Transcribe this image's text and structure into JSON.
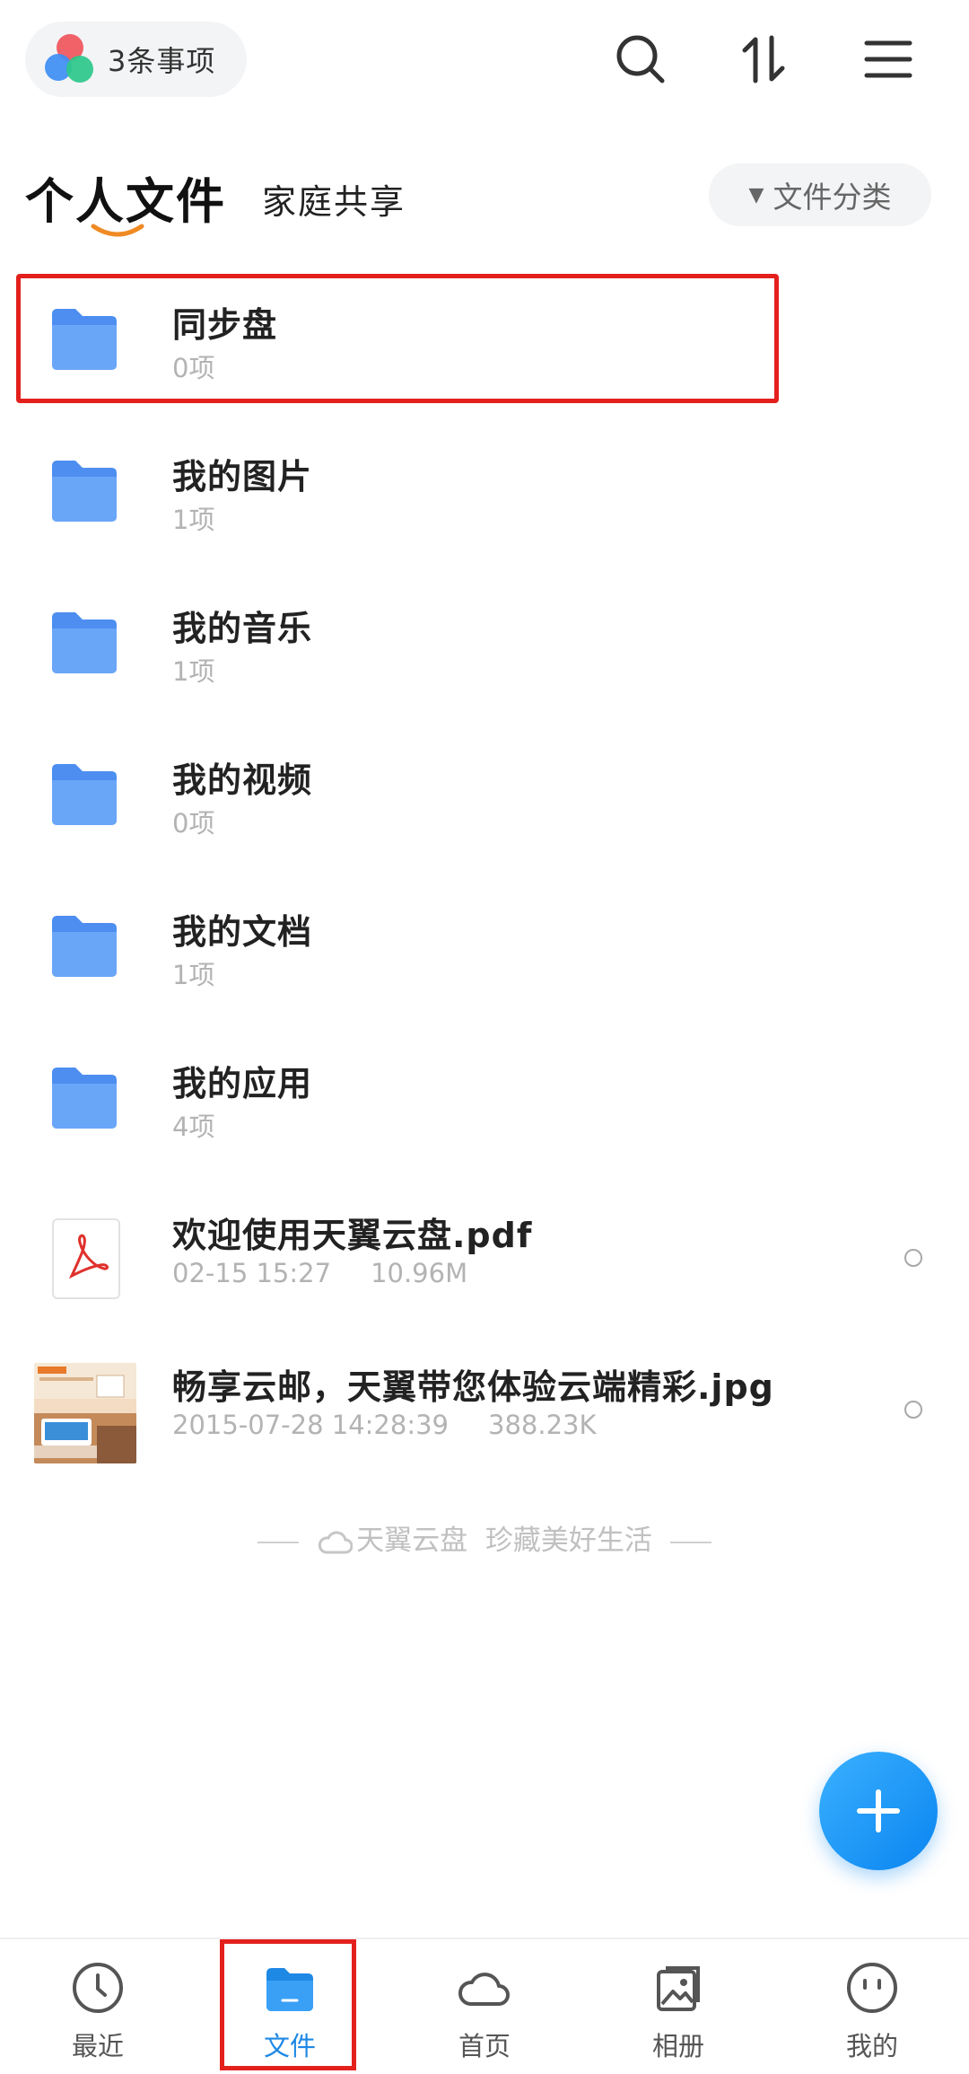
{
  "header": {
    "pill_label": "3条事项",
    "icons": [
      "search-icon",
      "sort-icon",
      "menu-icon"
    ]
  },
  "tabs": {
    "active": "个人文件",
    "other": "家庭共享",
    "category_button": "文件分类"
  },
  "files": [
    {
      "name": "同步盘",
      "meta": "0项",
      "type": "folder"
    },
    {
      "name": "我的图片",
      "meta": "1项",
      "type": "folder"
    },
    {
      "name": "我的音乐",
      "meta": "1项",
      "type": "folder"
    },
    {
      "name": "我的视频",
      "meta": "0项",
      "type": "folder"
    },
    {
      "name": "我的文档",
      "meta": "1项",
      "type": "folder"
    },
    {
      "name": "我的应用",
      "meta": "4项",
      "type": "folder"
    },
    {
      "name": "欢迎使用天翼云盘.pdf",
      "date": "02-15 15:27",
      "size": "10.96M",
      "type": "pdf"
    },
    {
      "name": "畅享云邮，天翼带您体验云端精彩.jpg",
      "date": "2015-07-28 14:28:39",
      "size": "388.23K",
      "type": "image"
    }
  ],
  "footer_slogan": "天翼云盘  珍藏美好生活",
  "bottom_nav": [
    {
      "label": "最近",
      "icon": "clock-icon"
    },
    {
      "label": "文件",
      "icon": "folder-icon",
      "active": true
    },
    {
      "label": "首页",
      "icon": "cloud-icon"
    },
    {
      "label": "相册",
      "icon": "album-icon"
    },
    {
      "label": "我的",
      "icon": "smiley-icon"
    }
  ],
  "colors": {
    "accent": "#1e88e5",
    "folder": "#5b9cf2",
    "highlight": "#e3201c",
    "fab": "#148cf0"
  }
}
